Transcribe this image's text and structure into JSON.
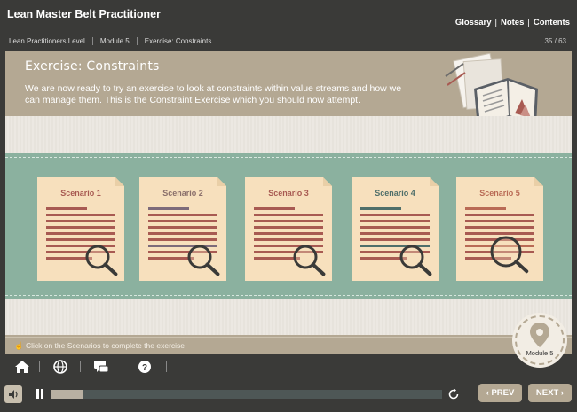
{
  "app": {
    "title": "Lean Master Belt Practitioner"
  },
  "top_links": {
    "glossary": "Glossary",
    "notes": "Notes",
    "contents": "Contents"
  },
  "breadcrumb": [
    "Lean Practitioners Level",
    "Module 5",
    "Exercise: Constraints"
  ],
  "page_counter": "35 / 63",
  "exercise": {
    "title": "Exercise: Constraints",
    "description": "We are now ready to try an exercise to look at constraints within value streams and how we can manage them. This is the Constraint Exercise which you should now attempt."
  },
  "scenarios": [
    {
      "label": "Scenario 1",
      "label_color": "#a85a52",
      "accent_color": "#a85a52"
    },
    {
      "label": "Scenario 2",
      "label_color": "#8a6f6b",
      "accent_color": "#7d6b7a"
    },
    {
      "label": "Scenario 3",
      "label_color": "#a85a52",
      "accent_color": "#a85a52"
    },
    {
      "label": "Scenario 4",
      "label_color": "#4f6f6a",
      "accent_color": "#4f6f6a"
    },
    {
      "label": "Scenario 5",
      "label_color": "#b96a55",
      "accent_color": "#b96a55"
    }
  ],
  "hint": "Click on the Scenarios to complete the exercise",
  "module_badge": {
    "label": "Module 5"
  },
  "toolbar": [
    "home-icon",
    "globe-icon",
    "chat-icon",
    "help-icon"
  ],
  "player": {
    "progress": 0.08,
    "prev_label": "PREV",
    "next_label": "NEXT",
    "prev_symbol": "‹",
    "next_symbol": "›"
  },
  "colors": {
    "stripe": "#a85a52",
    "green_band": "#8bb19f",
    "tan_band": "#b4a893",
    "paper": "#f7e0bd"
  }
}
